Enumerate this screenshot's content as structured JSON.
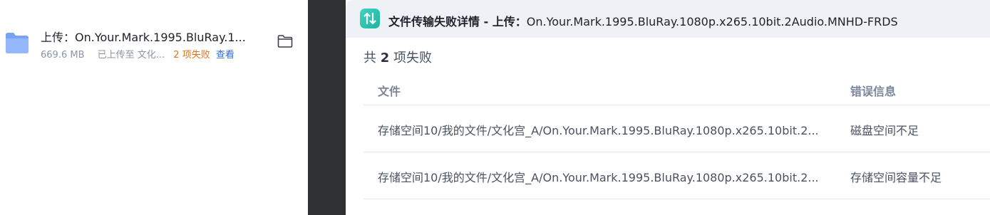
{
  "transfer_item": {
    "title": "上传：On.Your.Mark.1995.BluRay.1...",
    "size": "669.6 MB",
    "destination": "已上传至 文化...",
    "fail_count": "2 项失败",
    "view_link": "查看",
    "icon": "folder-icon",
    "action_icon": "open-folder-icon"
  },
  "dialog": {
    "icon": "transfer-arrows-icon",
    "title_prefix": "文件传输失败详情 - 上传：",
    "title_name": "On.Your.Mark.1995.BluRay.1080p.x265.10bit.2Audio.MNHD-FRDS",
    "summary_prefix": "共",
    "summary_count": "2",
    "summary_suffix": "项失败",
    "columns": {
      "file": "文件",
      "error": "错误信息"
    },
    "rows": [
      {
        "file": "存储空间10/我的文件/文化宫_A/On.Your.Mark.1995.BluRay.1080p.x265.10bit.2...",
        "error": "磁盘空间不足"
      },
      {
        "file": "存储空间10/我的文件/文化宫_A/On.Your.Mark.1995.BluRay.1080p.x265.10bit.2...",
        "error": "存储空间容量不足"
      }
    ]
  },
  "colors": {
    "fail_orange": "#e37318",
    "link_blue": "#2b6bd7",
    "overlay_dark": "#2f3032",
    "header_bg": "#eef1f6",
    "app_badge_teal": "#2cc3b0"
  }
}
